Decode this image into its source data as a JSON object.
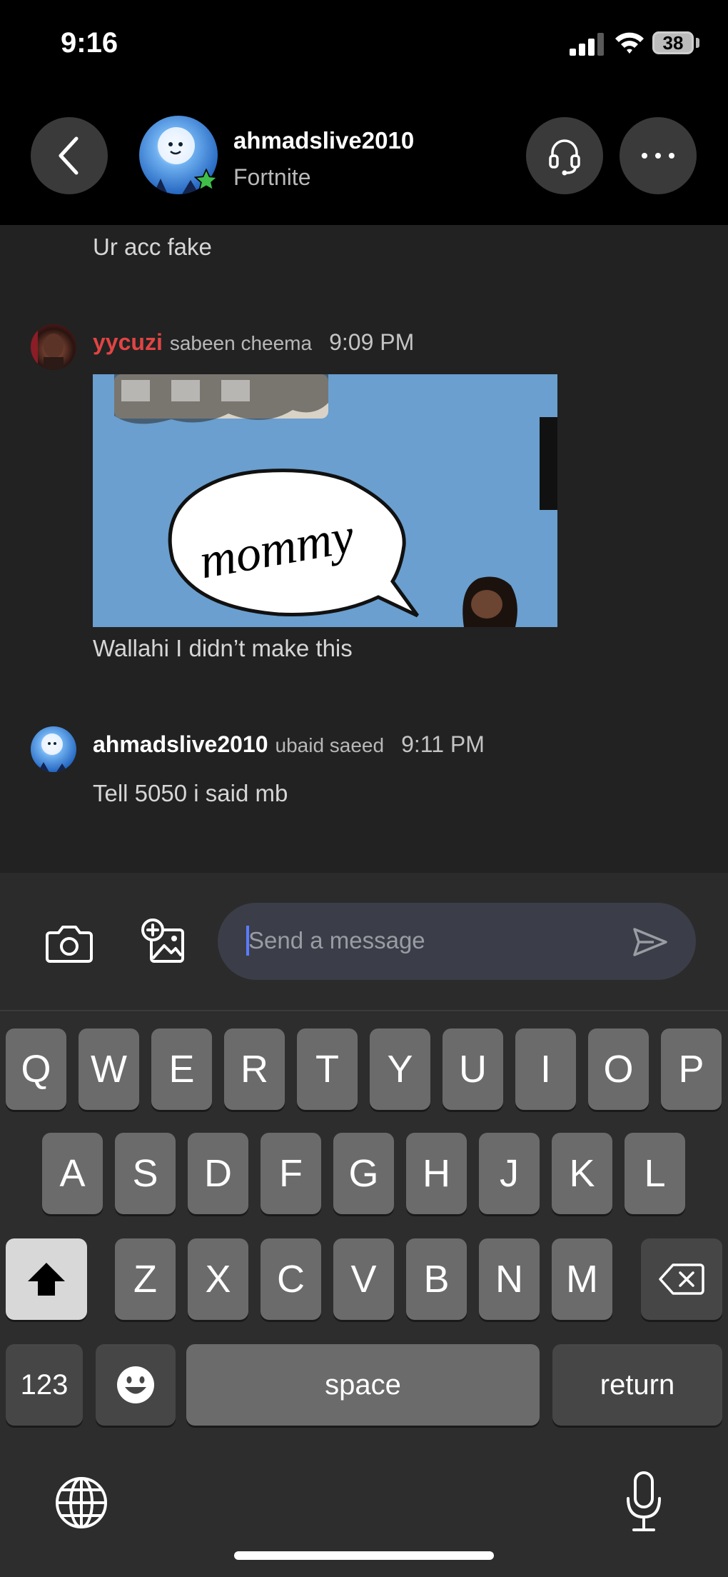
{
  "status_bar": {
    "time": "9:16",
    "battery": "38"
  },
  "header": {
    "username": "ahmadslive2010",
    "game": "Fortnite"
  },
  "chat": {
    "prev_message": "Ur acc fake",
    "messages": [
      {
        "username": "yycuzi",
        "realname": "sabeen cheema",
        "time": "9:09 PM",
        "gif_caption": "mommy",
        "text": "Wallahi I didn’t make this",
        "username_color": "#e24444"
      },
      {
        "username": "ahmadslive2010",
        "realname": "ubaid saeed",
        "time": "9:11 PM",
        "text": "Tell 5050 i said mb"
      }
    ]
  },
  "composer": {
    "placeholder": "Send a message"
  },
  "keyboard": {
    "row1": [
      "Q",
      "W",
      "E",
      "R",
      "T",
      "Y",
      "U",
      "I",
      "O",
      "P"
    ],
    "row2": [
      "A",
      "S",
      "D",
      "F",
      "G",
      "H",
      "J",
      "K",
      "L"
    ],
    "row3": [
      "Z",
      "X",
      "C",
      "V",
      "B",
      "N",
      "M"
    ],
    "numbers_label": "123",
    "space_label": "space",
    "return_label": "return"
  },
  "icons": [
    "back-icon",
    "headset-icon",
    "more-icon",
    "camera-icon",
    "add-image-icon",
    "send-icon",
    "shift-icon",
    "delete-icon",
    "emoji-icon",
    "globe-icon",
    "microphone-icon",
    "signal-icon",
    "wifi-icon"
  ]
}
